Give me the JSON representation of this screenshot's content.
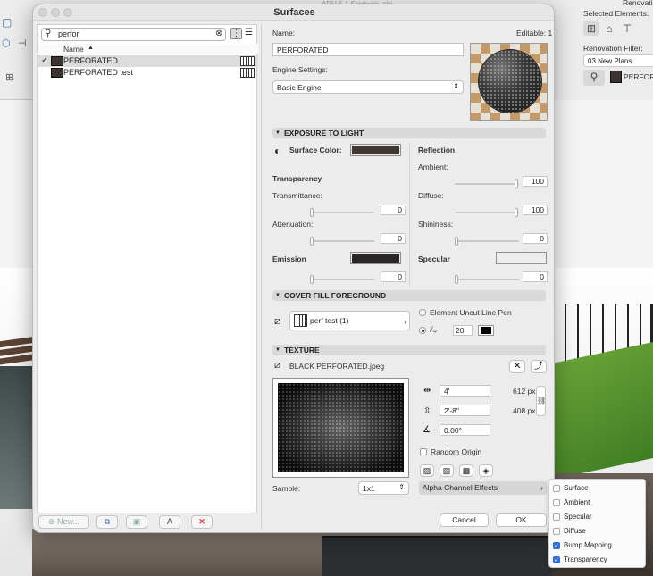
{
  "window": {
    "title": "Surfaces",
    "background_file_title": "ADU 5.1 Starbuck .pln"
  },
  "background_palette": {
    "top_label": "Renovation",
    "selected_elements_label": "Selected Elements:",
    "renovation_filter_label": "Renovation Filter:",
    "renovation_filter_value": "03 New Plans",
    "surface_value": "PERFORAT"
  },
  "search": {
    "value": "perfor"
  },
  "list": {
    "column_header": "Name",
    "rows": [
      {
        "name": "PERFORATED",
        "checked": true
      },
      {
        "name": "PERFORATED test",
        "checked": false
      }
    ]
  },
  "footer_left": {
    "new_label": "New...",
    "rename_label": "A"
  },
  "details": {
    "name_label": "Name:",
    "editable_text": "Editable: 1",
    "name_value": "PERFORATED",
    "engine_label": "Engine Settings:",
    "engine_value": "Basic Engine"
  },
  "exposure": {
    "section_title": "EXPOSURE TO LIGHT",
    "surface_color_label": "Surface Color:",
    "surface_color": "#3f3532",
    "transparency_label": "Transparency",
    "transmittance_label": "Transmittance:",
    "transmittance_value": "0",
    "attenuation_label": "Attenuation:",
    "attenuation_value": "0",
    "emission_label": "Emission",
    "emission_color": "#2a2626",
    "emission_value": "0",
    "reflection_label": "Reflection",
    "ambient_label": "Ambient:",
    "ambient_value": "100",
    "diffuse_label": "Diffuse:",
    "diffuse_value": "100",
    "shininess_label": "Shininess:",
    "shininess_value": "0",
    "specular_label": "Specular",
    "specular_color": "#ededed",
    "specular_value": "0"
  },
  "cover_fill": {
    "section_title": "COVER FILL FOREGROUND",
    "fill_value": "perf test (1)",
    "element_pen_label": "Element Uncut Line Pen",
    "pen_value": "20"
  },
  "texture": {
    "section_title": "TEXTURE",
    "file_name": "BLACK PERFORATED.jpeg",
    "width_value": "4'",
    "width_px": "612 px",
    "height_value": "2'-8\"",
    "height_px": "408 px",
    "angle_value": "0.00°",
    "random_origin_label": "Random Origin",
    "sample_label": "Sample:",
    "sample_value": "1x1",
    "alpha_label": "Alpha Channel Effects"
  },
  "alpha_menu": {
    "items": [
      {
        "label": "Surface",
        "checked": false
      },
      {
        "label": "Ambient",
        "checked": false
      },
      {
        "label": "Specular",
        "checked": false
      },
      {
        "label": "Diffuse",
        "checked": false
      },
      {
        "label": "Bump Mapping",
        "checked": true
      },
      {
        "label": "Transparency",
        "checked": true
      }
    ]
  },
  "buttons": {
    "cancel": "Cancel",
    "ok": "OK"
  },
  "accent_color": "#2f6fd6"
}
